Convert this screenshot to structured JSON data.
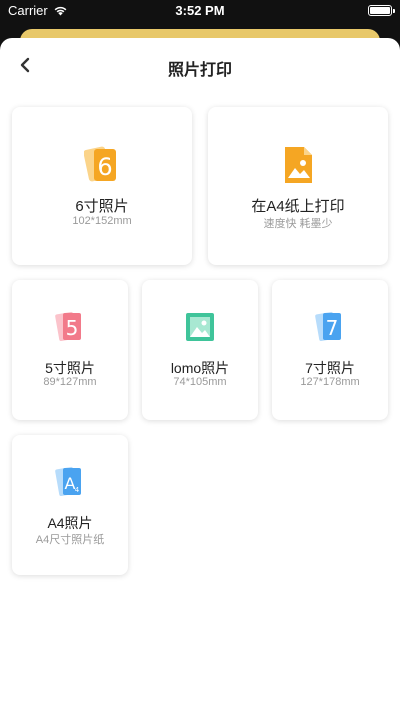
{
  "status": {
    "carrier": "Carrier",
    "time": "3:52 PM"
  },
  "nav": {
    "title": "照片打印"
  },
  "cards": [
    {
      "title": "6寸照片",
      "sub": "102*152mm",
      "icon": "photo-6-icon"
    },
    {
      "title": "在A4纸上打印",
      "sub": "速度快 耗墨少",
      "icon": "image-file-icon"
    },
    {
      "title": "5寸照片",
      "sub": "89*127mm",
      "icon": "photo-5-icon"
    },
    {
      "title": "lomo照片",
      "sub": "74*105mm",
      "icon": "lomo-image-icon"
    },
    {
      "title": "7寸照片",
      "sub": "127*178mm",
      "icon": "photo-7-icon"
    },
    {
      "title": "A4照片",
      "sub": "A4尺寸照片纸",
      "icon": "photo-a4-icon"
    }
  ],
  "colors": {
    "accent": "#e8c86a",
    "orange": "#f5a623",
    "pink": "#f27a8a",
    "green": "#3fc49a",
    "blue": "#4aa3f0"
  }
}
